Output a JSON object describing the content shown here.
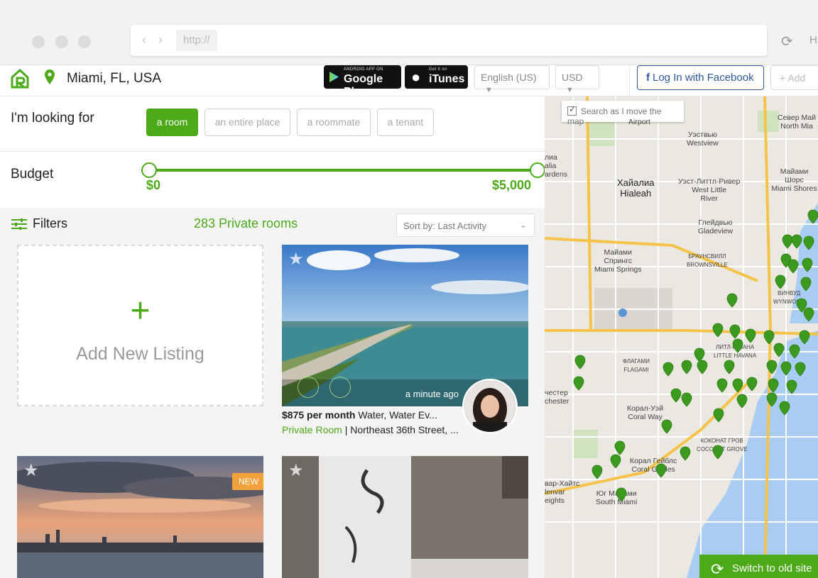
{
  "browser": {
    "nav_arrows": "‹ ›",
    "url": "http://",
    "reload_icon": "⟳",
    "partial_label": "H"
  },
  "header": {
    "location": "Miami, FL, USA",
    "google_play": {
      "small": "ANDROID APP ON",
      "big": "Google Play"
    },
    "itunes": {
      "small": "Get it on",
      "big": "iTunes"
    },
    "language": "English (US)",
    "currency": "USD",
    "facebook_login": "Log In with Facebook",
    "facebook_f": "f",
    "add_button": "+ Add"
  },
  "looking_for": {
    "label": "I'm looking for",
    "options": [
      {
        "label": "a room",
        "active": true
      },
      {
        "label": "an entire place",
        "active": false
      },
      {
        "label": "a roommate",
        "active": false
      },
      {
        "label": "a tenant",
        "active": false
      }
    ]
  },
  "budget": {
    "label": "Budget",
    "min": "$0",
    "max": "$5,000"
  },
  "listings": {
    "filters_label": "Filters",
    "count": "283 Private rooms",
    "sort": "Sort by: Last Activity",
    "add_new": {
      "plus": "+",
      "label": "Add New Listing"
    },
    "cards": [
      {
        "time": "a minute ago",
        "price": "$875 per month",
        "description": "Water, Water Ev...",
        "type": "Private Room",
        "address": " | Northeast 36th Street, ..."
      },
      {
        "badge": "NEW"
      },
      {}
    ]
  },
  "map": {
    "search_checkbox": "Search as I move the map",
    "switch_button": "Switch to old site",
    "labels": [
      "Север Май\nNorth Mia",
      "Уэствью\nWestview",
      "Хайалиа\nHialeah",
      "Уэст-Литтл-Ривер\nWest Little\nRiver",
      "Майами Шорс\nMiami Shores",
      "Глейдвью\nGladeview",
      "Майами\nСпрингс\nMiami Springs",
      "БРАУНСВИЛЛ\nBROWNSVILLE",
      "ВИНВУД\nWYNWOOD",
      "ЛИТЛ-ГАВАНА\nLITTLE HAVANA",
      "ФЛАГАМИ\nFLAGAMI",
      "Корал-Уэй\nCoral Way",
      "Корал Гейблс\nCoral Gables",
      "КОКОНАТ ГРОВ\nCOCONUT GROVE",
      "Юг Майами\nSouth Miami",
      "лиа\nalia\nardens",
      "честер\nchester",
      "вар-Хайтс\nlenvar\neights",
      "Airport"
    ]
  }
}
